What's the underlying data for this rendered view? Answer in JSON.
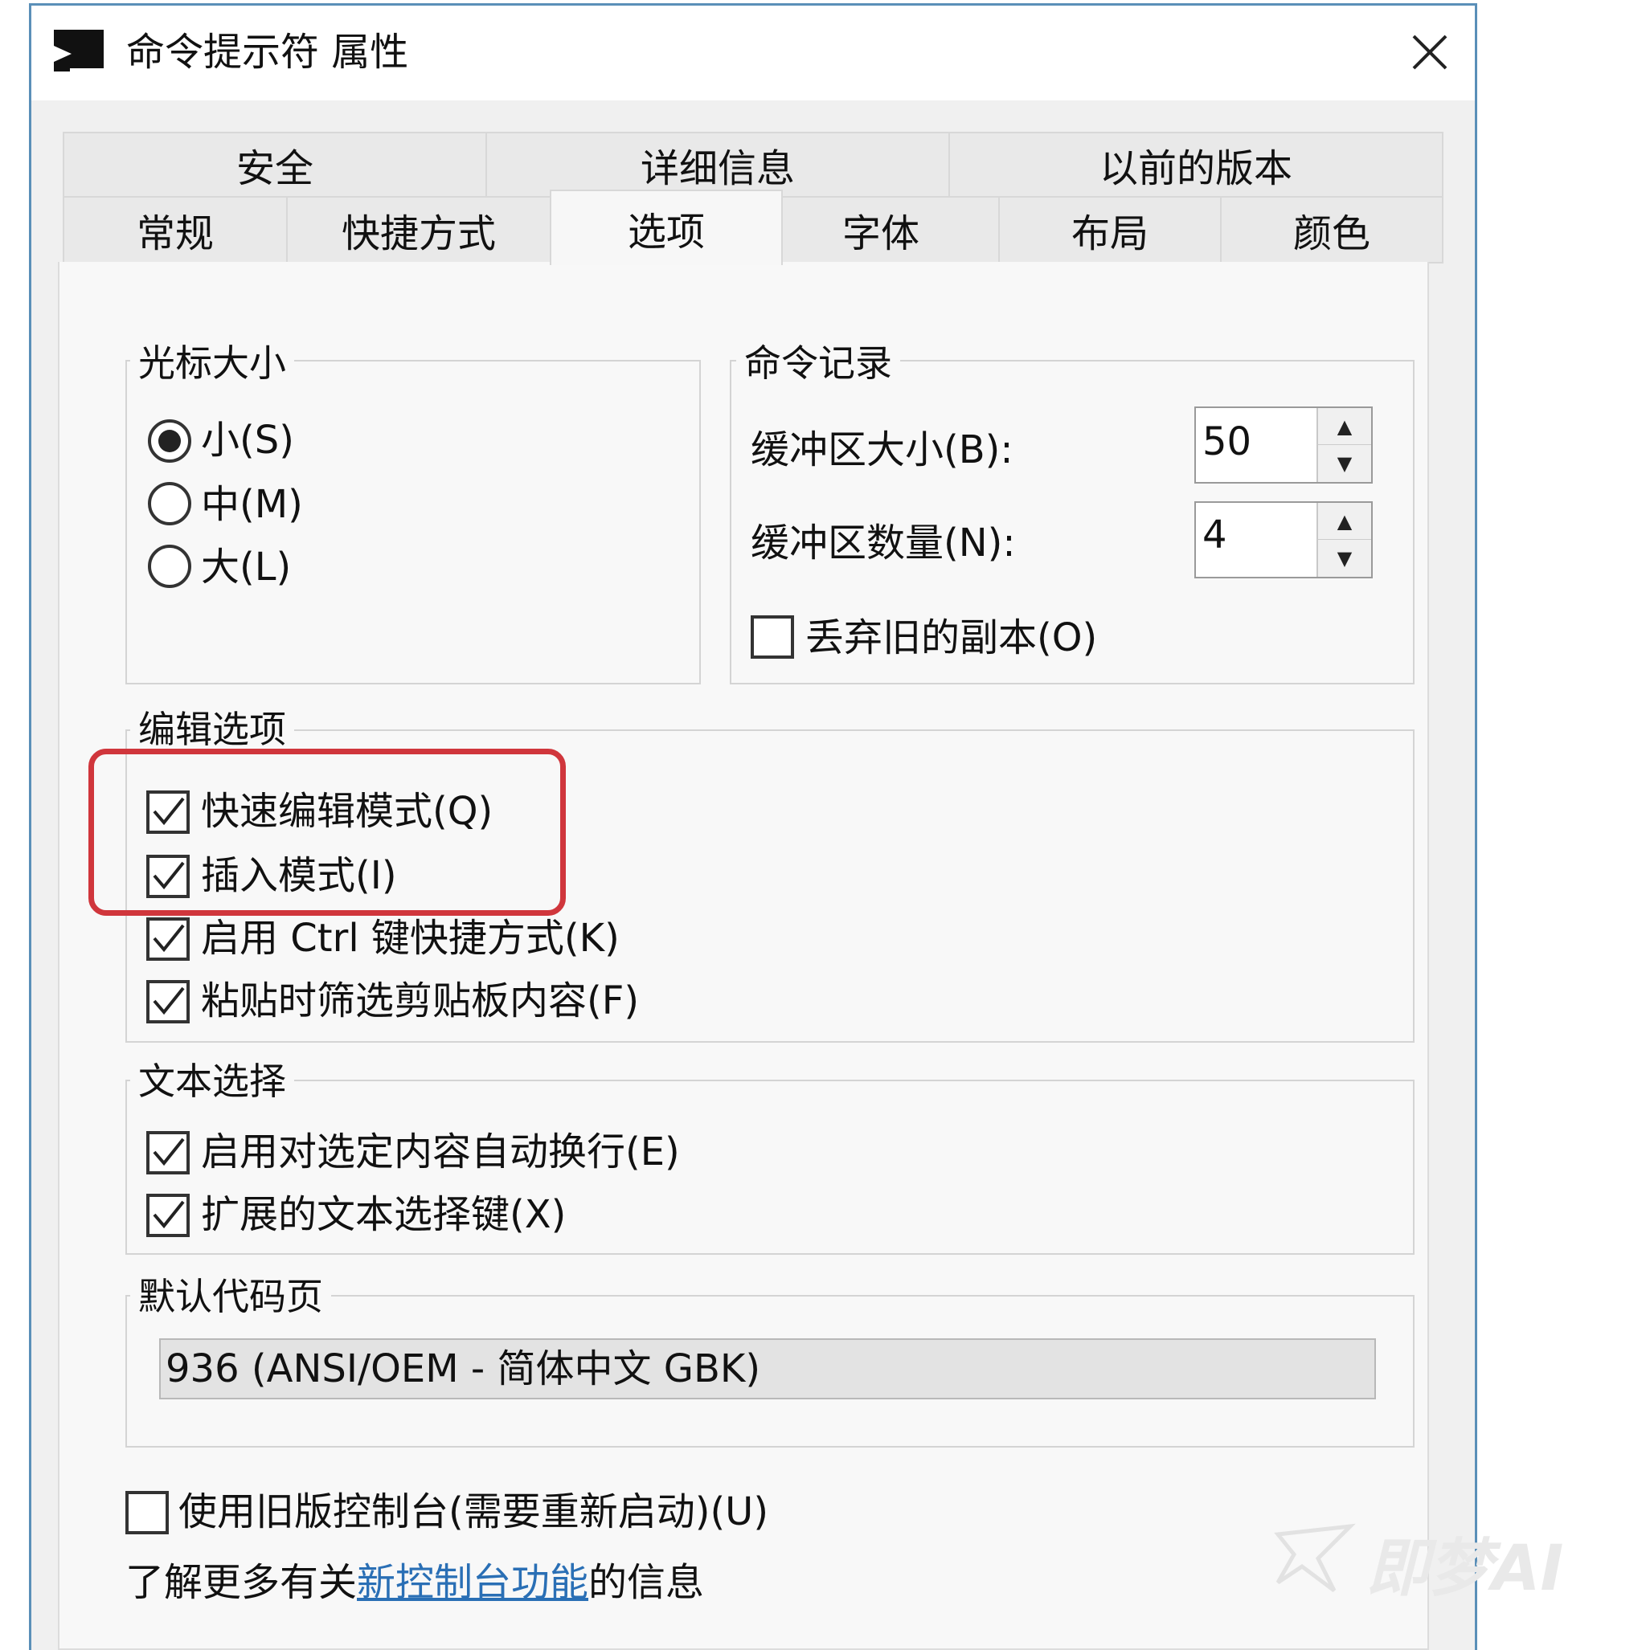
{
  "window": {
    "title": "命令提示符 属性"
  },
  "tabs_top": [
    "安全",
    "详细信息",
    "以前的版本"
  ],
  "tabs_bottom": [
    "常规",
    "快捷方式",
    "选项",
    "字体",
    "布局",
    "颜色"
  ],
  "active_tab": "选项",
  "cursor_size": {
    "title": "光标大小",
    "options": [
      {
        "label": "小(S)",
        "selected": true
      },
      {
        "label": "中(M)",
        "selected": false
      },
      {
        "label": "大(L)",
        "selected": false
      }
    ]
  },
  "command_history": {
    "title": "命令记录",
    "buffer_size_label": "缓冲区大小(B):",
    "buffer_size_value": "50",
    "buffer_count_label": "缓冲区数量(N):",
    "buffer_count_value": "4",
    "discard_old_label": "丢弃旧的副本(O)",
    "discard_old_checked": false
  },
  "edit_options": {
    "title": "编辑选项",
    "items": [
      {
        "label": "快速编辑模式(Q)",
        "checked": true
      },
      {
        "label": "插入模式(I)",
        "checked": true
      },
      {
        "label": "启用 Ctrl 键快捷方式(K)",
        "checked": true
      },
      {
        "label": "粘贴时筛选剪贴板内容(F)",
        "checked": true
      }
    ]
  },
  "text_selection": {
    "title": "文本选择",
    "items": [
      {
        "label": "启用对选定内容自动换行(E)",
        "checked": true
      },
      {
        "label": "扩展的文本选择键(X)",
        "checked": true
      }
    ]
  },
  "code_page": {
    "title": "默认代码页",
    "value": "936   (ANSI/OEM - 简体中文 GBK)"
  },
  "legacy_console": {
    "label": "使用旧版控制台(需要重新启动)(U)",
    "checked": false
  },
  "learn_more": {
    "prefix": "了解更多有关",
    "link": "新控制台功能",
    "suffix": "的信息"
  },
  "watermark": "即梦AI",
  "colors": {
    "highlight": "#d0363c",
    "link": "#2a6fb5",
    "window_border": "#5a8fb8"
  }
}
